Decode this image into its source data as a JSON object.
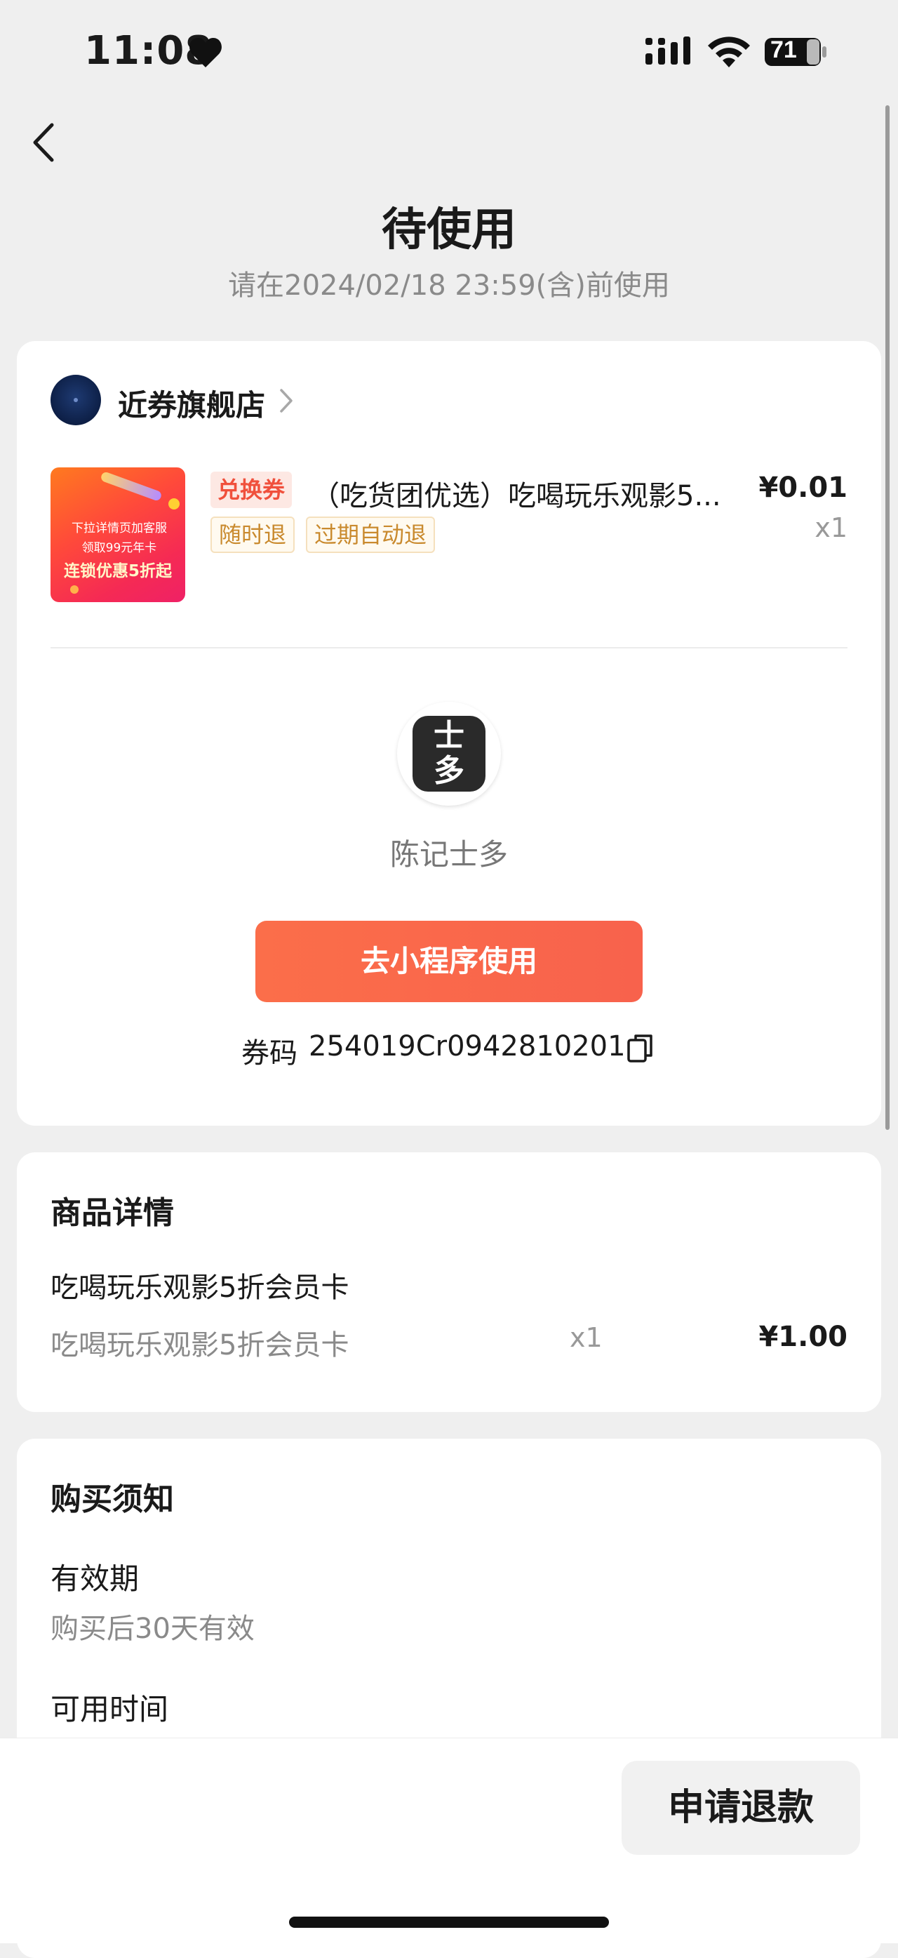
{
  "status_bar": {
    "time": "11:08",
    "battery": "71"
  },
  "header": {
    "title": "待使用",
    "subtitle": "请在2024/02/18 23:59(含)前使用"
  },
  "order": {
    "shop_name": "近券旗舰店",
    "product": {
      "tag": "兑换券",
      "title": "（吃货团优选）吃喝玩乐观影5...",
      "price": "¥0.01",
      "qty": "x1",
      "image_text": [
        "下拉详情页加客服",
        "领取99元年卡",
        "连锁优惠5折起"
      ],
      "policy_tags": [
        "随时退",
        "过期自动退"
      ]
    },
    "merchant": {
      "logo_glyph": "士多",
      "name": "陈记士多"
    },
    "use_button": "去小程序使用",
    "code_label": "券码",
    "code_value": "254019Cr0942810201"
  },
  "product_detail": {
    "title": "商品详情",
    "name": "吃喝玩乐观影5折会员卡",
    "sub_name": "吃喝玩乐观影5折会员卡",
    "qty": "x1",
    "price": "¥1.00"
  },
  "notice": {
    "title": "购买须知",
    "items": [
      {
        "label": "有效期",
        "value": "购买后30天有效"
      },
      {
        "label": "可用时间",
        "value": ""
      }
    ]
  },
  "bottom": {
    "refund_button": "申请退款"
  },
  "colors": {
    "accent": "#f8624c",
    "tag_red": "#f0503c",
    "tag_gold": "#c98a2e",
    "background": "#efefef"
  }
}
